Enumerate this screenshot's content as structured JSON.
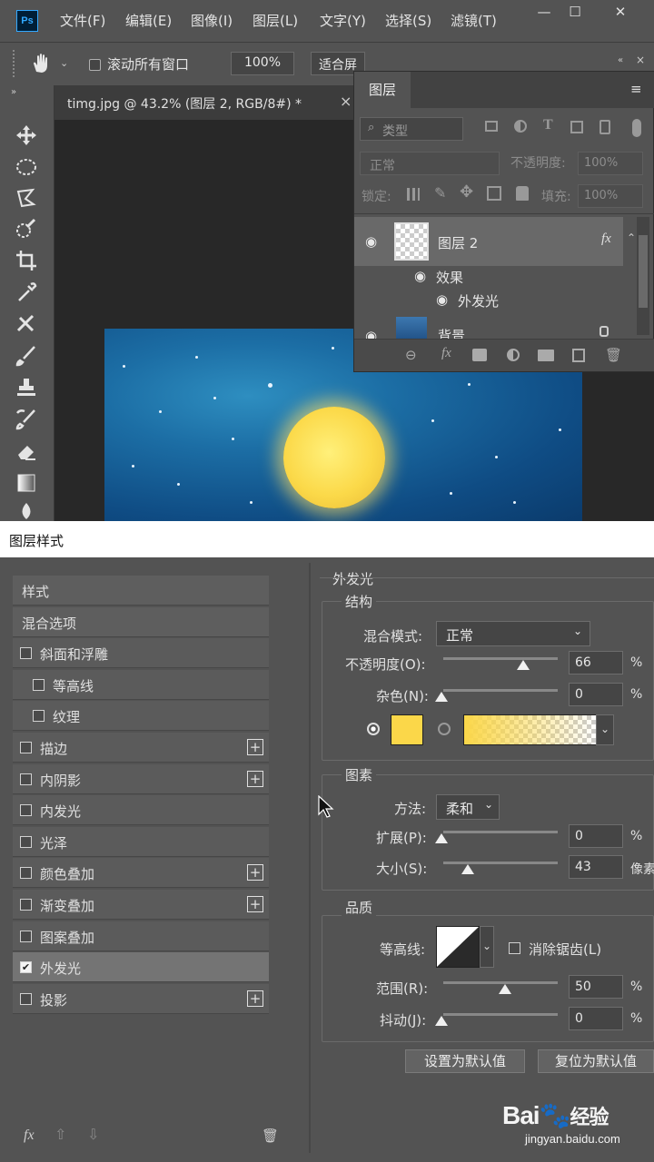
{
  "app": {
    "logo": "Ps",
    "menu": [
      "文件(F)",
      "编辑(E)",
      "图像(I)",
      "图层(L)",
      "文字(Y)",
      "选择(S)",
      "滤镜(T)"
    ],
    "window_controls": [
      "—",
      "☐",
      "✕"
    ]
  },
  "options_bar": {
    "scroll_all_label": "滚动所有窗口",
    "zoom_value": "100%",
    "fit_label": "适合屏"
  },
  "document": {
    "tab_title": "timg.jpg @ 43.2% (图层 2, RGB/8#) *",
    "tab_close": "×"
  },
  "layers_panel": {
    "tab": "图层",
    "filter_placeholder": "类型",
    "blend_mode": "正常",
    "opacity_label": "不透明度:",
    "opacity_value": "100%",
    "lock_label": "锁定:",
    "fill_label": "填充:",
    "fill_value": "100%",
    "layers": [
      {
        "name": "图层 2",
        "fx": "fx"
      },
      {
        "name": "背景"
      }
    ],
    "effects_label": "效果",
    "effect_item": "外发光"
  },
  "dialog": {
    "title": "图层样式",
    "style_list": [
      {
        "label": "样式",
        "checkbox": false,
        "checked": false,
        "plus": false,
        "indent": false
      },
      {
        "label": "混合选项",
        "checkbox": false,
        "checked": false,
        "plus": false,
        "indent": false
      },
      {
        "label": "斜面和浮雕",
        "checkbox": true,
        "checked": false,
        "plus": false,
        "indent": false
      },
      {
        "label": "等高线",
        "checkbox": true,
        "checked": false,
        "plus": false,
        "indent": true
      },
      {
        "label": "纹理",
        "checkbox": true,
        "checked": false,
        "plus": false,
        "indent": true
      },
      {
        "label": "描边",
        "checkbox": true,
        "checked": false,
        "plus": true,
        "indent": false
      },
      {
        "label": "内阴影",
        "checkbox": true,
        "checked": false,
        "plus": true,
        "indent": false
      },
      {
        "label": "内发光",
        "checkbox": true,
        "checked": false,
        "plus": false,
        "indent": false
      },
      {
        "label": "光泽",
        "checkbox": true,
        "checked": false,
        "plus": false,
        "indent": false
      },
      {
        "label": "颜色叠加",
        "checkbox": true,
        "checked": false,
        "plus": true,
        "indent": false
      },
      {
        "label": "渐变叠加",
        "checkbox": true,
        "checked": false,
        "plus": true,
        "indent": false
      },
      {
        "label": "图案叠加",
        "checkbox": true,
        "checked": false,
        "plus": false,
        "indent": false
      },
      {
        "label": "外发光",
        "checkbox": true,
        "checked": true,
        "plus": false,
        "indent": false,
        "selected": true
      },
      {
        "label": "投影",
        "checkbox": true,
        "checked": false,
        "plus": true,
        "indent": false
      }
    ],
    "outer_glow": {
      "heading": "外发光",
      "structure": {
        "heading": "结构",
        "blend_label": "混合模式:",
        "blend_value": "正常",
        "opacity_label": "不透明度(O):",
        "opacity_value": "66",
        "noise_label": "杂色(N):",
        "noise_value": "0",
        "unit": "%",
        "glow_color": "#fbd749"
      },
      "elements": {
        "heading": "图素",
        "method_label": "方法:",
        "method_value": "柔和",
        "spread_label": "扩展(P):",
        "spread_value": "0",
        "size_label": "大小(S):",
        "size_value": "43",
        "size_unit": "像素",
        "unit": "%"
      },
      "quality": {
        "heading": "品质",
        "contour_label": "等高线:",
        "antialias_label": "消除锯齿(L)",
        "range_label": "范围(R):",
        "range_value": "50",
        "jitter_label": "抖动(J):",
        "jitter_value": "0",
        "unit": "%"
      },
      "set_default": "设置为默认值",
      "reset_default": "复位为默认值"
    },
    "bottom_fx": "fx"
  },
  "watermark": {
    "brand": "Bai",
    "brand2": "经验",
    "url": "jingyan.baidu.com"
  }
}
